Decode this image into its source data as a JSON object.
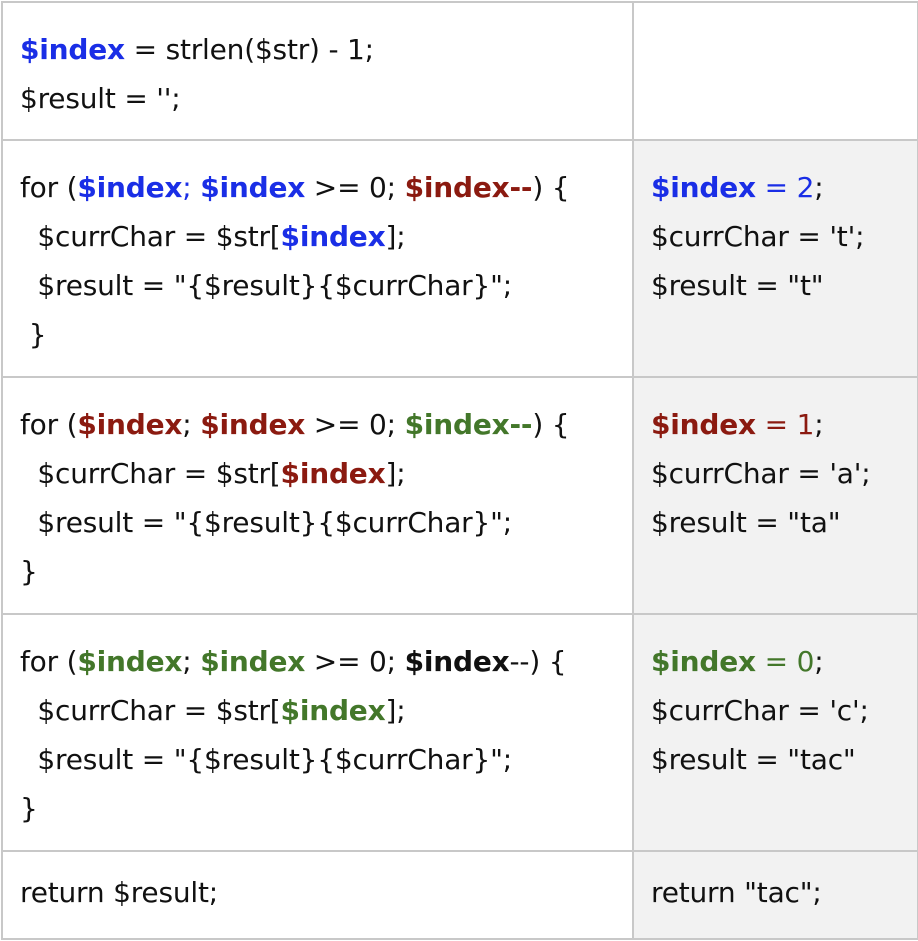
{
  "rows": [
    {
      "code": [
        [
          {
            "t": "$index",
            "c": "blue",
            "b": true
          },
          {
            "t": " = strlen($str) - 1;"
          }
        ],
        [
          {
            "t": "$result = '';"
          }
        ]
      ],
      "state": [],
      "state_shaded": false
    },
    {
      "code": [
        [
          {
            "t": "for ("
          },
          {
            "t": "$index",
            "c": "blue",
            "b": true
          },
          {
            "t": "; ",
            "c": "blue"
          },
          {
            "t": "$index",
            "c": "blue",
            "b": true
          },
          {
            "t": " >= 0; "
          },
          {
            "t": "$index--",
            "c": "red",
            "b": true
          },
          {
            "t": ") {"
          }
        ],
        [
          {
            "t": "  $currChar = $str["
          },
          {
            "t": "$index",
            "c": "blue",
            "b": true
          },
          {
            "t": "];"
          }
        ],
        [
          {
            "t": "  $result = \"{$result}{$currChar}\";"
          }
        ],
        [
          {
            "t": " }"
          }
        ]
      ],
      "state": [
        [
          {
            "t": "$index",
            "c": "blue",
            "b": true
          },
          {
            "t": " = 2",
            "c": "blue"
          },
          {
            "t": ";"
          }
        ],
        [
          {
            "t": "$currChar = 't';"
          }
        ],
        [
          {
            "t": "$result = \"t\""
          }
        ]
      ],
      "state_shaded": true
    },
    {
      "code": [
        [
          {
            "t": "for ("
          },
          {
            "t": "$index",
            "c": "red",
            "b": true
          },
          {
            "t": "; "
          },
          {
            "t": "$index",
            "c": "red",
            "b": true
          },
          {
            "t": " >= 0; "
          },
          {
            "t": "$index--",
            "c": "green",
            "b": true
          },
          {
            "t": ") {"
          }
        ],
        [
          {
            "t": "  $currChar = $str["
          },
          {
            "t": "$index",
            "c": "red",
            "b": true
          },
          {
            "t": "];"
          }
        ],
        [
          {
            "t": "  $result = \"{$result}{$currChar}\";"
          }
        ],
        [
          {
            "t": "}"
          }
        ]
      ],
      "state": [
        [
          {
            "t": "$index",
            "c": "red",
            "b": true
          },
          {
            "t": " = 1",
            "c": "red"
          },
          {
            "t": ";"
          }
        ],
        [
          {
            "t": "$currChar = 'a';"
          }
        ],
        [
          {
            "t": "$result = \"ta\""
          }
        ]
      ],
      "state_shaded": true
    },
    {
      "code": [
        [
          {
            "t": "for ("
          },
          {
            "t": "$index",
            "c": "green",
            "b": true
          },
          {
            "t": "; "
          },
          {
            "t": "$index",
            "c": "green",
            "b": true
          },
          {
            "t": " >= 0; "
          },
          {
            "t": "$index",
            "b": true
          },
          {
            "t": "--) {"
          }
        ],
        [
          {
            "t": "  $currChar = $str["
          },
          {
            "t": "$index",
            "c": "green",
            "b": true
          },
          {
            "t": "];"
          }
        ],
        [
          {
            "t": "  $result = \"{$result}{$currChar}\";"
          }
        ],
        [
          {
            "t": "}"
          }
        ]
      ],
      "state": [
        [
          {
            "t": "$index",
            "c": "green",
            "b": true
          },
          {
            "t": " = 0",
            "c": "green"
          },
          {
            "t": ";"
          }
        ],
        [
          {
            "t": "$currChar = 'c';"
          }
        ],
        [
          {
            "t": "$result = \"tac\""
          }
        ]
      ],
      "state_shaded": true
    },
    {
      "code": [
        [
          {
            "t": "return $result;"
          }
        ]
      ],
      "state": [
        [
          {
            "t": "return \"tac\";"
          }
        ]
      ],
      "state_shaded": true
    }
  ],
  "colors": {
    "blue": "#1a2ee6",
    "red": "#8b1a10",
    "green": "#43772a",
    "default": "#111111",
    "shaded_cell": "#f2f2f2",
    "border": "#c8c8c8"
  }
}
